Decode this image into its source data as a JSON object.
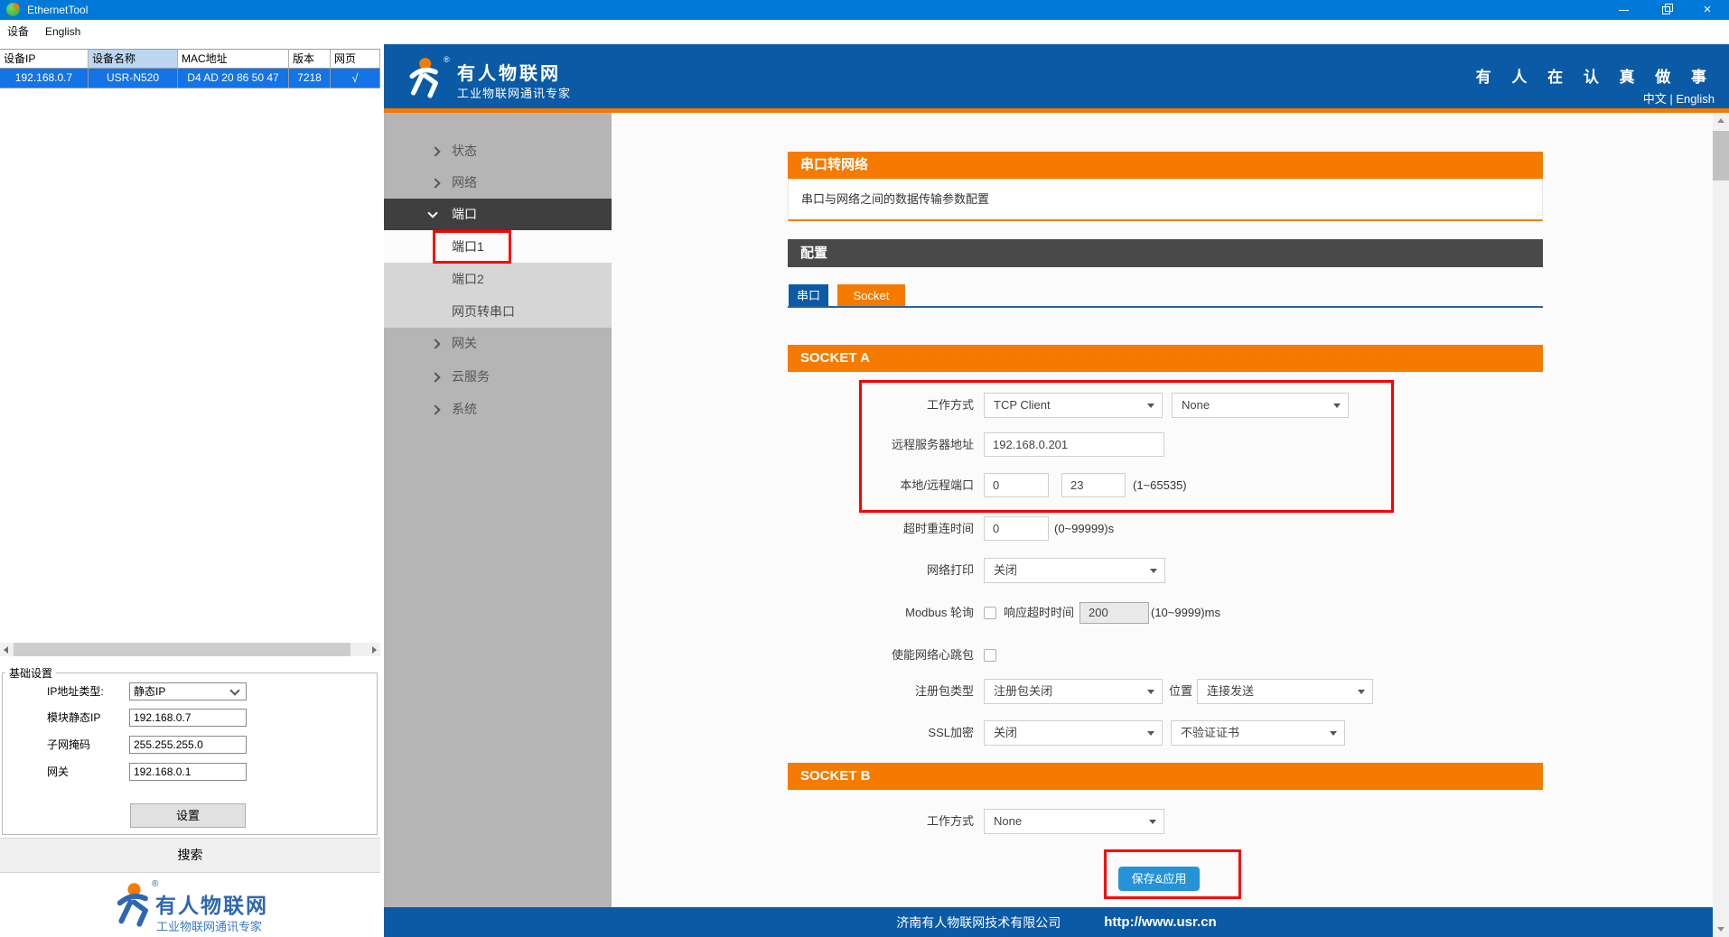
{
  "window": {
    "title": "EthernetTool",
    "menu": [
      "设备",
      "English"
    ]
  },
  "device_table": {
    "headers": [
      "设备IP",
      "设备名称",
      "MAC地址",
      "版本",
      "网页"
    ],
    "row": [
      "192.168.0.7",
      "USR-N520",
      "D4 AD 20 86 50 47",
      "7218",
      "√"
    ]
  },
  "basic": {
    "legend": "基础设置",
    "ip_type_label": "IP地址类型:",
    "ip_type_value": "静态IP",
    "static_ip_label": "模块静态IP",
    "static_ip_value": "192.168.0.7",
    "mask_label": "子网掩码",
    "mask_value": "255.255.255.0",
    "gateway_label": "网关",
    "gateway_value": "192.168.0.1",
    "set_button": "设置",
    "search_button": "搜索"
  },
  "left_logo": {
    "brand": "有人物联网",
    "slogan": "工业物联网通讯专家",
    "reg": "®"
  },
  "web": {
    "header": {
      "brand": "有人物联网",
      "brand_sub": "工业物联网通讯专家",
      "slogan": "有 人 在 认 真 做 事",
      "lang": "中文 | English",
      "reg": "®"
    },
    "nav": {
      "items": [
        {
          "label": "状态"
        },
        {
          "label": "网络"
        },
        {
          "label": "端口"
        },
        {
          "label": "端口1"
        },
        {
          "label": "端口2"
        },
        {
          "label": "网页转串口"
        },
        {
          "label": "网关"
        },
        {
          "label": "云服务"
        },
        {
          "label": "系统"
        }
      ]
    },
    "page": {
      "title": "串口转网络",
      "desc": "串口与网络之间的数据传输参数配置",
      "config": "配置",
      "tab_serial": "串口",
      "tab_socket": "Socket"
    },
    "socket_a": {
      "title": "SOCKET A",
      "work_mode_label": "工作方式",
      "work_mode": "TCP Client",
      "work_mode2": "None",
      "remote_label": "远程服务器地址",
      "remote_value": "192.168.0.201",
      "port_label": "本地/远程端口",
      "local_port": "0",
      "remote_port": "23",
      "port_hint": "(1~65535)",
      "reconnect_label": "超时重连时间",
      "reconnect_value": "0",
      "reconnect_hint": "(0~99999)s",
      "print_label": "网络打印",
      "print_value": "关闭",
      "modbus_label": "Modbus 轮询",
      "modbus_sub_label": "响应超时时间",
      "modbus_value": "200",
      "modbus_hint": "(10~9999)ms",
      "heartbeat_label": "使能网络心跳包",
      "regpkt_label": "注册包类型",
      "regpkt_value": "注册包关闭",
      "regpkt_pos_label": "位置",
      "regpkt_pos_value": "连接发送",
      "ssl_label": "SSL加密",
      "ssl_value": "关闭",
      "ssl_cert_value": "不验证证书"
    },
    "socket_b": {
      "title": "SOCKET B",
      "work_mode_label": "工作方式",
      "work_mode": "None"
    },
    "save_button": "保存&应用",
    "footer": {
      "company": "济南有人物联网技术有限公司",
      "url": "http://www.usr.cn"
    }
  },
  "colors": {
    "titlebar_blue": "#0078d7",
    "web_blue": "#0b5aa5",
    "accent_orange": "#f57b00",
    "save_blue": "#2593d5",
    "annotation_red": "#ff0000",
    "selected_row_blue": "#1473e6"
  }
}
